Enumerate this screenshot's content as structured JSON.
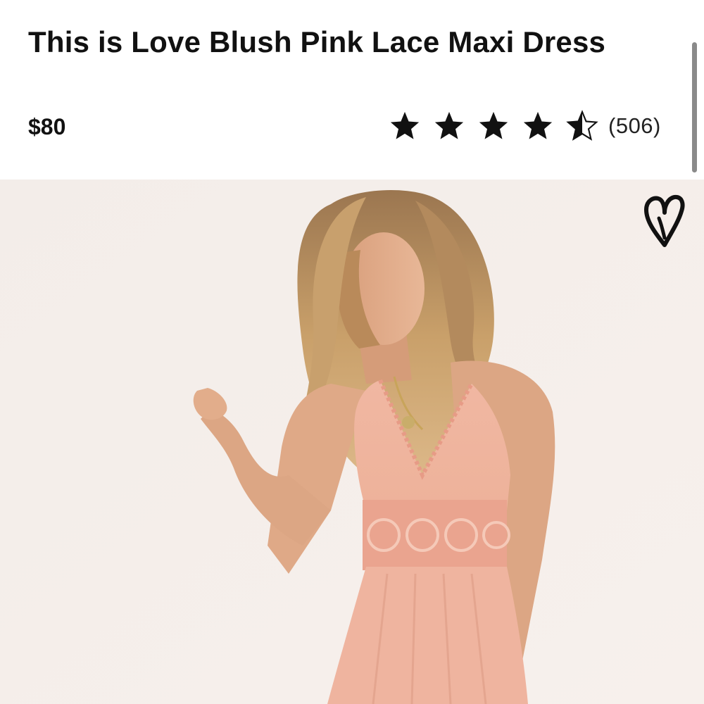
{
  "product": {
    "title": "This is Love Blush Pink Lace Maxi Dress",
    "price": "$80",
    "rating": {
      "value": 4.5,
      "max": 5,
      "review_count_text": "(506)"
    }
  },
  "icons": {
    "star": "star-icon",
    "half_star": "half-star-icon",
    "favorite": "heart-icon"
  },
  "colors": {
    "text": "#111111",
    "star": "#111111",
    "photo_background": "#f4ede9",
    "dress": "#efb49f"
  }
}
